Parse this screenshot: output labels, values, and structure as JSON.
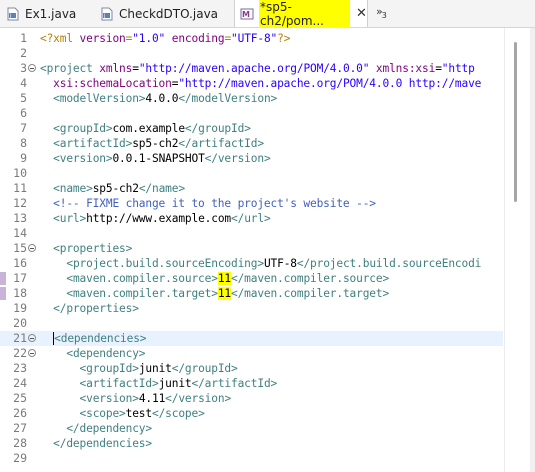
{
  "tabs": [
    {
      "label": "Ex1.java",
      "icon": "java-file-icon",
      "active": false
    },
    {
      "label": "CheckdDTO.java",
      "icon": "java-file-icon",
      "active": false
    },
    {
      "label": "*sp5-ch2/pom...",
      "icon": "maven-pom-icon",
      "active": true,
      "close": "✕"
    }
  ],
  "overflow": {
    "glyph": "»",
    "count": "3"
  },
  "colors": {
    "tag": "#3f7f7f",
    "attr": "#7f007f",
    "value": "#2a00ff",
    "comment": "#3f5fbf",
    "highlight": "#ffff00",
    "current_line": "#e8f2fe"
  },
  "lines": [
    {
      "n": "1",
      "fold": false,
      "mark": false,
      "current": false,
      "segs": [
        [
          "pi",
          "<?xml "
        ],
        [
          "attr",
          "version"
        ],
        [
          "pi",
          "="
        ],
        [
          "val",
          "\"1.0\""
        ],
        [
          "pi",
          " "
        ],
        [
          "attr",
          "encoding"
        ],
        [
          "pi",
          "="
        ],
        [
          "val",
          "\"UTF-8\""
        ],
        [
          "pi",
          "?>"
        ]
      ]
    },
    {
      "n": "2",
      "fold": false,
      "mark": false,
      "current": false,
      "segs": []
    },
    {
      "n": "3",
      "fold": true,
      "mark": false,
      "current": false,
      "segs": [
        [
          "tag",
          "<"
        ],
        [
          "ename",
          "project"
        ],
        [
          "txt",
          " "
        ],
        [
          "attr",
          "xmlns"
        ],
        [
          "txt",
          "="
        ],
        [
          "val",
          "\"http://maven.apache.org/POM/4.0.0\""
        ],
        [
          "txt",
          " "
        ],
        [
          "attr",
          "xmlns:xsi"
        ],
        [
          "txt",
          "="
        ],
        [
          "val",
          "\"http"
        ]
      ]
    },
    {
      "n": "4",
      "fold": false,
      "mark": false,
      "current": false,
      "segs": [
        [
          "txt",
          "  "
        ],
        [
          "attr",
          "xsi:schemaLocation"
        ],
        [
          "txt",
          "="
        ],
        [
          "val",
          "\"http://maven.apache.org/POM/4.0.0 http://mave"
        ]
      ]
    },
    {
      "n": "5",
      "fold": false,
      "mark": false,
      "current": false,
      "segs": [
        [
          "txt",
          "  "
        ],
        [
          "tag",
          "<"
        ],
        [
          "ename",
          "modelVersion"
        ],
        [
          "tag",
          ">"
        ],
        [
          "txt",
          "4.0.0"
        ],
        [
          "tag",
          "</"
        ],
        [
          "ename",
          "modelVersion"
        ],
        [
          "tag",
          ">"
        ]
      ]
    },
    {
      "n": "6",
      "fold": false,
      "mark": false,
      "current": false,
      "segs": []
    },
    {
      "n": "7",
      "fold": false,
      "mark": false,
      "current": false,
      "segs": [
        [
          "txt",
          "  "
        ],
        [
          "tag",
          "<"
        ],
        [
          "ename",
          "groupId"
        ],
        [
          "tag",
          ">"
        ],
        [
          "txt",
          "com.example"
        ],
        [
          "tag",
          "</"
        ],
        [
          "ename",
          "groupId"
        ],
        [
          "tag",
          ">"
        ]
      ]
    },
    {
      "n": "8",
      "fold": false,
      "mark": false,
      "current": false,
      "segs": [
        [
          "txt",
          "  "
        ],
        [
          "tag",
          "<"
        ],
        [
          "ename",
          "artifactId"
        ],
        [
          "tag",
          ">"
        ],
        [
          "txt",
          "sp5-ch2"
        ],
        [
          "tag",
          "</"
        ],
        [
          "ename",
          "artifactId"
        ],
        [
          "tag",
          ">"
        ]
      ]
    },
    {
      "n": "9",
      "fold": false,
      "mark": false,
      "current": false,
      "segs": [
        [
          "txt",
          "  "
        ],
        [
          "tag",
          "<"
        ],
        [
          "ename",
          "version"
        ],
        [
          "tag",
          ">"
        ],
        [
          "txt",
          "0.0.1-SNAPSHOT"
        ],
        [
          "tag",
          "</"
        ],
        [
          "ename",
          "version"
        ],
        [
          "tag",
          ">"
        ]
      ]
    },
    {
      "n": "10",
      "fold": false,
      "mark": false,
      "current": false,
      "segs": []
    },
    {
      "n": "11",
      "fold": false,
      "mark": false,
      "current": false,
      "segs": [
        [
          "txt",
          "  "
        ],
        [
          "tag",
          "<"
        ],
        [
          "ename",
          "name"
        ],
        [
          "tag",
          ">"
        ],
        [
          "txt",
          "sp5-ch2"
        ],
        [
          "tag",
          "</"
        ],
        [
          "ename",
          "name"
        ],
        [
          "tag",
          ">"
        ]
      ]
    },
    {
      "n": "12",
      "fold": false,
      "mark": false,
      "current": false,
      "segs": [
        [
          "txt",
          "  "
        ],
        [
          "comment",
          "<!-- FIXME change it to the project's website -->"
        ]
      ]
    },
    {
      "n": "13",
      "fold": false,
      "mark": false,
      "current": false,
      "segs": [
        [
          "txt",
          "  "
        ],
        [
          "tag",
          "<"
        ],
        [
          "ename",
          "url"
        ],
        [
          "tag",
          ">"
        ],
        [
          "txt",
          "http://www.example.com"
        ],
        [
          "tag",
          "</"
        ],
        [
          "ename",
          "url"
        ],
        [
          "tag",
          ">"
        ]
      ]
    },
    {
      "n": "14",
      "fold": false,
      "mark": false,
      "current": false,
      "segs": []
    },
    {
      "n": "15",
      "fold": true,
      "mark": false,
      "current": false,
      "segs": [
        [
          "txt",
          "  "
        ],
        [
          "tag",
          "<"
        ],
        [
          "ename",
          "properties"
        ],
        [
          "tag",
          ">"
        ]
      ]
    },
    {
      "n": "16",
      "fold": false,
      "mark": false,
      "current": false,
      "segs": [
        [
          "txt",
          "    "
        ],
        [
          "tag",
          "<"
        ],
        [
          "ename",
          "project.build.sourceEncoding"
        ],
        [
          "tag",
          ">"
        ],
        [
          "txt",
          "UTF-8"
        ],
        [
          "tag",
          "</"
        ],
        [
          "ename",
          "project.build.sourceEncodi"
        ]
      ]
    },
    {
      "n": "17",
      "fold": false,
      "mark": true,
      "current": false,
      "segs": [
        [
          "txt",
          "    "
        ],
        [
          "tag",
          "<"
        ],
        [
          "ename",
          "maven.compiler.source"
        ],
        [
          "tag",
          ">"
        ],
        [
          "hl",
          "11"
        ],
        [
          "tag",
          "</"
        ],
        [
          "ename",
          "maven.compiler.source"
        ],
        [
          "tag",
          ">"
        ]
      ]
    },
    {
      "n": "18",
      "fold": false,
      "mark": true,
      "current": false,
      "segs": [
        [
          "txt",
          "    "
        ],
        [
          "tag",
          "<"
        ],
        [
          "ename",
          "maven.compiler.target"
        ],
        [
          "tag",
          ">"
        ],
        [
          "hl",
          "11"
        ],
        [
          "tag",
          "</"
        ],
        [
          "ename",
          "maven.compiler.target"
        ],
        [
          "tag",
          ">"
        ]
      ]
    },
    {
      "n": "19",
      "fold": false,
      "mark": false,
      "current": false,
      "segs": [
        [
          "txt",
          "  "
        ],
        [
          "tag",
          "</"
        ],
        [
          "ename",
          "properties"
        ],
        [
          "tag",
          ">"
        ]
      ]
    },
    {
      "n": "20",
      "fold": false,
      "mark": false,
      "current": false,
      "segs": []
    },
    {
      "n": "21",
      "fold": true,
      "mark": false,
      "current": true,
      "segs": [
        [
          "txt",
          "  "
        ],
        [
          "caret",
          ""
        ],
        [
          "tag",
          "<"
        ],
        [
          "ename",
          "dependencies"
        ],
        [
          "tag",
          ">"
        ]
      ]
    },
    {
      "n": "22",
      "fold": true,
      "mark": false,
      "current": false,
      "segs": [
        [
          "txt",
          "    "
        ],
        [
          "tag",
          "<"
        ],
        [
          "ename",
          "dependency"
        ],
        [
          "tag",
          ">"
        ]
      ]
    },
    {
      "n": "23",
      "fold": false,
      "mark": false,
      "current": false,
      "segs": [
        [
          "txt",
          "      "
        ],
        [
          "tag",
          "<"
        ],
        [
          "ename",
          "groupId"
        ],
        [
          "tag",
          ">"
        ],
        [
          "txt",
          "junit"
        ],
        [
          "tag",
          "</"
        ],
        [
          "ename",
          "groupId"
        ],
        [
          "tag",
          ">"
        ]
      ]
    },
    {
      "n": "24",
      "fold": false,
      "mark": false,
      "current": false,
      "segs": [
        [
          "txt",
          "      "
        ],
        [
          "tag",
          "<"
        ],
        [
          "ename",
          "artifactId"
        ],
        [
          "tag",
          ">"
        ],
        [
          "txt",
          "junit"
        ],
        [
          "tag",
          "</"
        ],
        [
          "ename",
          "artifactId"
        ],
        [
          "tag",
          ">"
        ]
      ]
    },
    {
      "n": "25",
      "fold": false,
      "mark": false,
      "current": false,
      "segs": [
        [
          "txt",
          "      "
        ],
        [
          "tag",
          "<"
        ],
        [
          "ename",
          "version"
        ],
        [
          "tag",
          ">"
        ],
        [
          "txt",
          "4.11"
        ],
        [
          "tag",
          "</"
        ],
        [
          "ename",
          "version"
        ],
        [
          "tag",
          ">"
        ]
      ]
    },
    {
      "n": "26",
      "fold": false,
      "mark": false,
      "current": false,
      "segs": [
        [
          "txt",
          "      "
        ],
        [
          "tag",
          "<"
        ],
        [
          "ename",
          "scope"
        ],
        [
          "tag",
          ">"
        ],
        [
          "txt",
          "test"
        ],
        [
          "tag",
          "</"
        ],
        [
          "ename",
          "scope"
        ],
        [
          "tag",
          ">"
        ]
      ]
    },
    {
      "n": "27",
      "fold": false,
      "mark": false,
      "current": false,
      "segs": [
        [
          "txt",
          "    "
        ],
        [
          "tag",
          "</"
        ],
        [
          "ename",
          "dependency"
        ],
        [
          "tag",
          ">"
        ]
      ]
    },
    {
      "n": "28",
      "fold": false,
      "mark": false,
      "current": false,
      "segs": [
        [
          "txt",
          "  "
        ],
        [
          "tag",
          "</"
        ],
        [
          "ename",
          "dependencies"
        ],
        [
          "tag",
          ">"
        ]
      ]
    },
    {
      "n": "29",
      "fold": false,
      "mark": false,
      "current": false,
      "segs": []
    }
  ]
}
